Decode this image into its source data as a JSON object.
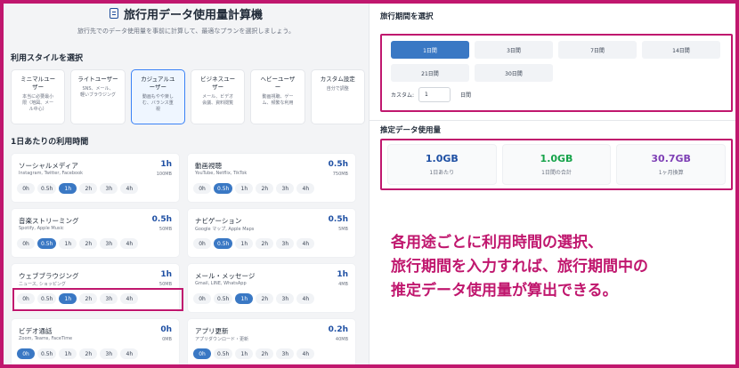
{
  "header": {
    "title": "旅行用データ使用量計算機",
    "subtitle": "旅行先でのデータ使用量を事前に計算して、最適なプランを選択しましょう。"
  },
  "styles_section": {
    "heading": "利用スタイルを選択",
    "items": [
      {
        "name": "ミニマルユー\nザー",
        "desc": "本当に必要最小\n限（地図、メー\nル中心）"
      },
      {
        "name": "ライトユーザー",
        "desc": "SNS、メール、\n軽いブラウジング"
      },
      {
        "name": "カジュアルユ\nーザー",
        "desc": "動画もやや楽し\nむ、バランス重\n視"
      },
      {
        "name": "ビジネスユー\nザー",
        "desc": "メール、ビデオ\n会議、資料閲覧"
      },
      {
        "name": "ヘビーユーザ\nー",
        "desc": "動画視聴、ゲー\nム、頻繁な利用"
      },
      {
        "name": "カスタム設定",
        "desc": "自分で調整"
      }
    ],
    "active_index": 2
  },
  "usage_section": {
    "heading": "1日あたりの利用時間",
    "hour_options": [
      "0h",
      "0.5h",
      "1h",
      "2h",
      "3h",
      "4h"
    ],
    "items": [
      {
        "name": "ソーシャルメディア",
        "sub": "Instagram, Twitter, Facebook",
        "hours": "1h",
        "mb": "100MB",
        "selected": 2
      },
      {
        "name": "動画視聴",
        "sub": "YouTube, Netflix, TikTok",
        "hours": "0.5h",
        "mb": "750MB",
        "selected": 1
      },
      {
        "name": "音楽ストリーミング",
        "sub": "Spotify, Apple Music",
        "hours": "0.5h",
        "mb": "50MB",
        "selected": 1
      },
      {
        "name": "ナビゲーション",
        "sub": "Google マップ, Apple Maps",
        "hours": "0.5h",
        "mb": "5MB",
        "selected": 1
      },
      {
        "name": "ウェブブラウジング",
        "sub": "ニュース, ショッピング",
        "hours": "1h",
        "mb": "50MB",
        "selected": 2
      },
      {
        "name": "メール・メッセージ",
        "sub": "Gmail, LINE, WhatsApp",
        "hours": "1h",
        "mb": "4MB",
        "selected": 2
      },
      {
        "name": "ビデオ通話",
        "sub": "Zoom, Teams, FaceTime",
        "hours": "0h",
        "mb": "0MB",
        "selected": 0
      },
      {
        "name": "アプリ更新",
        "sub": "アプリダウンロード・更新",
        "hours": "0.2h",
        "mb": "40MB",
        "selected": 0
      }
    ]
  },
  "period_section": {
    "heading": "旅行期間を選択",
    "options": [
      "1日間",
      "3日間",
      "7日間",
      "14日間",
      "21日間",
      "30日間"
    ],
    "selected_index": 0,
    "custom_label": "カスタム:",
    "custom_value": "1",
    "custom_unit": "日間"
  },
  "estimate_section": {
    "heading": "推定データ使用量",
    "items": [
      {
        "value": "1.0GB",
        "caption": "1日あたり",
        "color": "#1e4fa3"
      },
      {
        "value": "1.0GB",
        "caption": "1日間の合計",
        "color": "#16a34a"
      },
      {
        "value": "30.7GB",
        "caption": "1ヶ月換算",
        "color": "#7e3fb5"
      }
    ]
  },
  "annotation": {
    "lines": [
      "各用途ごとに利用時間の選択、",
      "旅行期間を入力すれば、旅行期間中の",
      "推定データ使用量が算出できる。"
    ],
    "color": "#c0176e"
  }
}
